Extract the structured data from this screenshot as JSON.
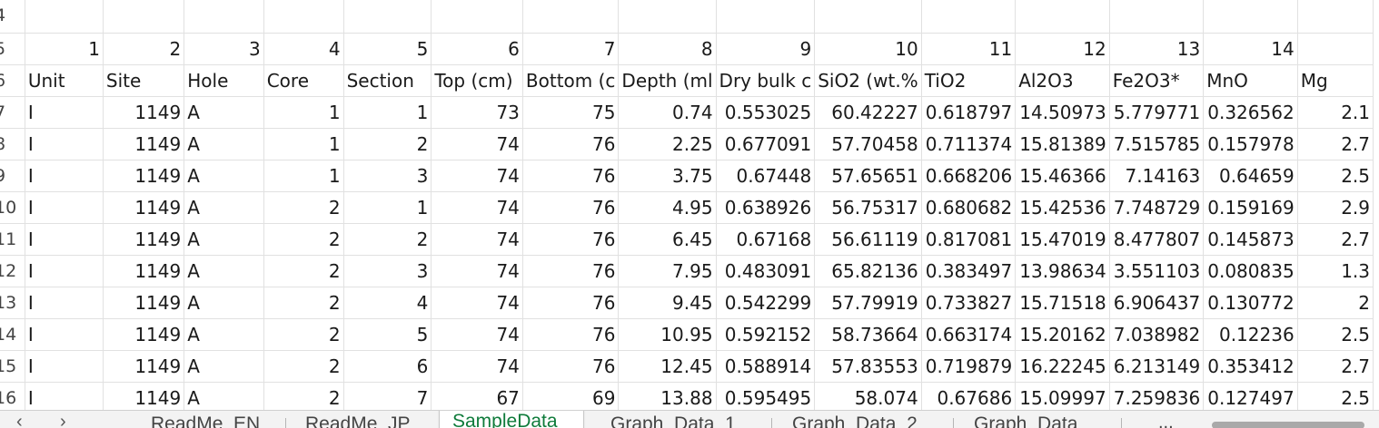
{
  "row_numbers": [
    "4",
    "5",
    "6",
    "7",
    "8",
    "9",
    "10",
    "11",
    "12",
    "13",
    "14",
    "15",
    "16"
  ],
  "column_numbers": [
    "",
    "1",
    "2",
    "3",
    "4",
    "5",
    "6",
    "7",
    "8",
    "9",
    "10",
    "11",
    "12",
    "13",
    "14",
    ""
  ],
  "headers": [
    "Unit",
    "Site",
    "Hole",
    "Core",
    "Section",
    "Top (cm)",
    "Bottom (c",
    "Depth (ml",
    "Dry bulk c",
    "SiO2 (wt.%",
    "TiO2",
    "Al2O3",
    "Fe2O3*",
    "MnO",
    "Mg"
  ],
  "rows": [
    [
      "I",
      "1149",
      "A",
      "1",
      "1",
      "73",
      "75",
      "0.74",
      "0.553025",
      "60.42227",
      "0.618797",
      "14.50973",
      "5.779771",
      "0.326562",
      "2.1"
    ],
    [
      "I",
      "1149",
      "A",
      "1",
      "2",
      "74",
      "76",
      "2.25",
      "0.677091",
      "57.70458",
      "0.711374",
      "15.81389",
      "7.515785",
      "0.157978",
      "2.7"
    ],
    [
      "I",
      "1149",
      "A",
      "1",
      "3",
      "74",
      "76",
      "3.75",
      "0.67448",
      "57.65651",
      "0.668206",
      "15.46366",
      "7.14163",
      "0.64659",
      "2.5"
    ],
    [
      "I",
      "1149",
      "A",
      "2",
      "1",
      "74",
      "76",
      "4.95",
      "0.638926",
      "56.75317",
      "0.680682",
      "15.42536",
      "7.748729",
      "0.159169",
      "2.9"
    ],
    [
      "I",
      "1149",
      "A",
      "2",
      "2",
      "74",
      "76",
      "6.45",
      "0.67168",
      "56.61119",
      "0.817081",
      "15.47019",
      "8.477807",
      "0.145873",
      "2.7"
    ],
    [
      "I",
      "1149",
      "A",
      "2",
      "3",
      "74",
      "76",
      "7.95",
      "0.483091",
      "65.82136",
      "0.383497",
      "13.98634",
      "3.551103",
      "0.080835",
      "1.3"
    ],
    [
      "I",
      "1149",
      "A",
      "2",
      "4",
      "74",
      "76",
      "9.45",
      "0.542299",
      "57.79919",
      "0.733827",
      "15.71518",
      "6.906437",
      "0.130772",
      "2"
    ],
    [
      "I",
      "1149",
      "A",
      "2",
      "5",
      "74",
      "76",
      "10.95",
      "0.592152",
      "58.73664",
      "0.663174",
      "15.20162",
      "7.038982",
      "0.12236",
      "2.5"
    ],
    [
      "I",
      "1149",
      "A",
      "2",
      "6",
      "74",
      "76",
      "12.45",
      "0.588914",
      "57.83553",
      "0.719879",
      "16.22245",
      "6.213149",
      "0.353412",
      "2.7"
    ],
    [
      "I",
      "1149",
      "A",
      "2",
      "7",
      "67",
      "69",
      "13.88",
      "0.595495",
      "58.074",
      "0.67686",
      "15.09997",
      "7.259836",
      "0.127497",
      "2.5"
    ]
  ],
  "tabs": {
    "readme_en": "ReadMe_EN",
    "readme_jp": "ReadMe_JP",
    "sampledata": "SampleData",
    "graph1": "Graph_Data_1",
    "graph2": "Graph_Data_2",
    "graphd": "Graph_Data",
    "more": "..."
  },
  "colors": {
    "active_tab_text": "#0f7b3b",
    "gridline": "#e1e1e1"
  }
}
